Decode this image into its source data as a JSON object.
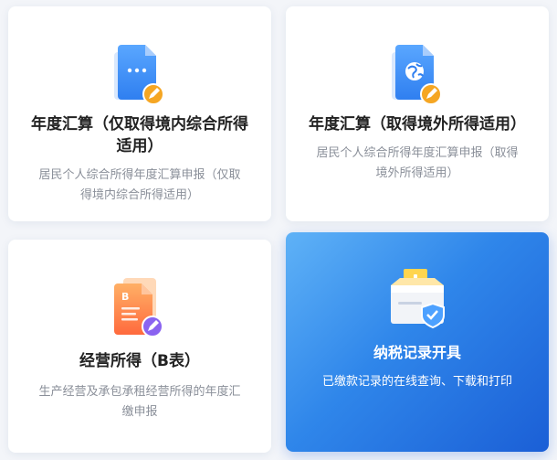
{
  "cards": [
    {
      "title": "年度汇算（仅取得境内综合所得适用）",
      "desc": "居民个人综合所得年度汇算申报（仅取得境内综合所得适用）",
      "icon": "document-chat-edit-icon"
    },
    {
      "title": "年度汇算（取得境外所得适用）",
      "desc": "居民个人综合所得年度汇算申报（取得境外所得适用）",
      "icon": "document-globe-edit-icon"
    },
    {
      "title": "经营所得（B表）",
      "desc": "生产经营及承包承租经营所得的年度汇缴申报",
      "icon": "document-b-edit-icon",
      "icon_letter": "B"
    },
    {
      "title": "纳税记录开具",
      "desc": "已缴款记录的在线查询、下载和打印",
      "icon": "tax-record-inbox-icon"
    }
  ],
  "colors": {
    "active_card_gradient_start": "#5fb2f7",
    "active_card_gradient_end": "#1b5fd6",
    "edit_badge_orange": "#f5a623",
    "edit_badge_purple": "#8a63f0",
    "doc_blue": "#3d8ef0",
    "doc_orange": "#ff7a45"
  }
}
